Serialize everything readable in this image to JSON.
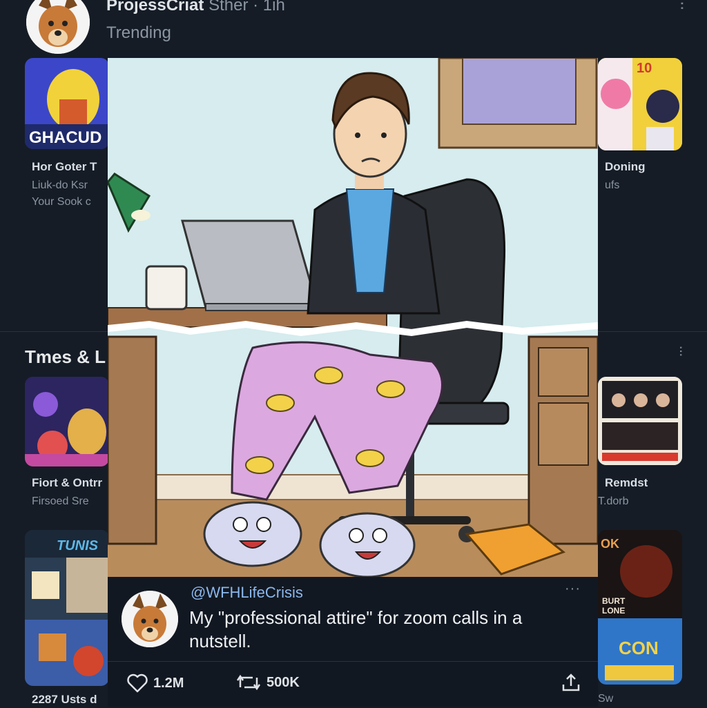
{
  "header": {
    "name": "ProjessCriat",
    "meta": "Sther · 1ih",
    "subtitle": "Trending"
  },
  "left_cards": [
    {
      "thumb_text": "GHACUD",
      "title": "Hor Goter T",
      "line1": "Liuk-do Ksr",
      "line2": "Your  Sook c"
    },
    {
      "thumb_text": "",
      "title": "Fiort & Ontrr",
      "line1": "Firsoed Sre",
      "line2": ""
    },
    {
      "thumb_text": "TUNIS",
      "title": "",
      "line1": "",
      "line2": ""
    }
  ],
  "right_cards": [
    {
      "thumb_text": "10",
      "title": "Doning",
      "line1": "ufs"
    },
    {
      "thumb_text": "",
      "title": "Remdst",
      "line1": "T.dorb"
    },
    {
      "thumb_text": "CON",
      "thumb_text2": "OK",
      "thumb_text3": "BURT LONE",
      "title": "",
      "line1": "Sw"
    }
  ],
  "section": {
    "title": "Tmes & L"
  },
  "footer_left": "2287 Usts d",
  "post": {
    "handle": "@WFHLifeCrisis",
    "text": "My \"professional attire\" for zoom calls in a nutstell.",
    "likes": "1.2M",
    "reposts": "500K"
  },
  "colors": {
    "background": "#151c26",
    "card": "#121821",
    "handle": "#8bb8ee",
    "wall": "#d7eef0",
    "pajama": "#dca8e0"
  },
  "icons": [
    "heart-icon",
    "repost-icon",
    "share-icon",
    "more-icon"
  ]
}
